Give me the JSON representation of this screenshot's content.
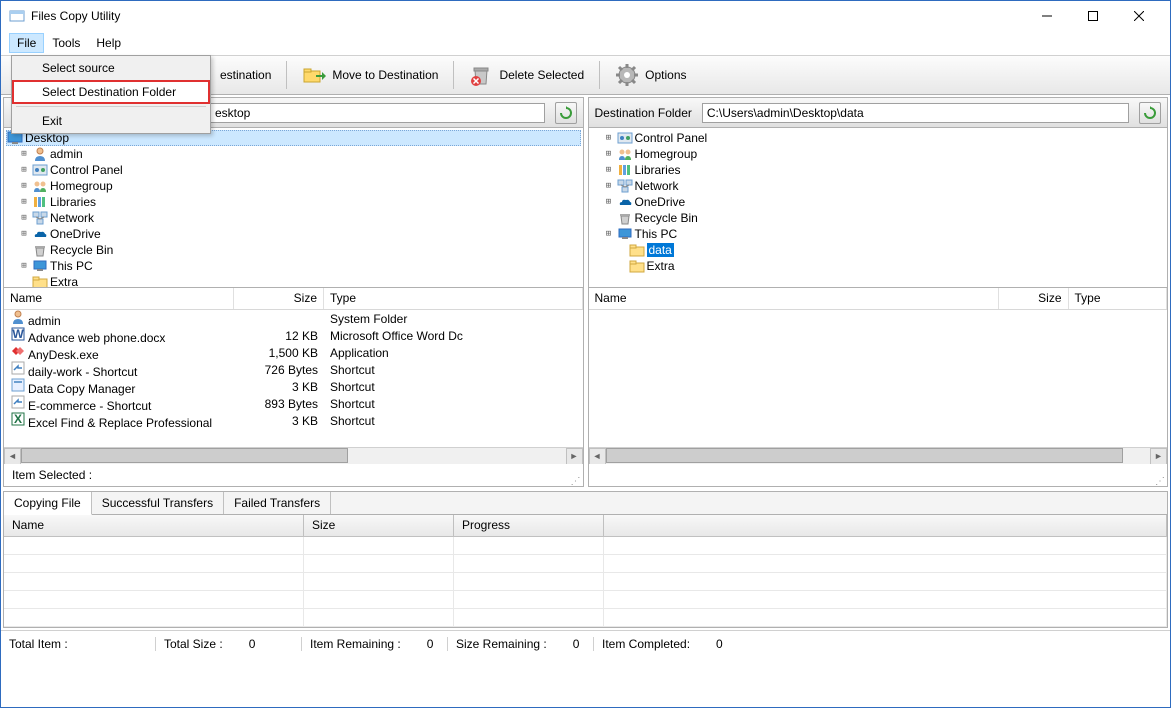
{
  "window": {
    "title": "Files Copy Utility"
  },
  "menubar": {
    "file": "File",
    "tools": "Tools",
    "help": "Help"
  },
  "fileMenu": {
    "select_source": "Select source",
    "select_dest": "Select Destination Folder",
    "exit": "Exit"
  },
  "toolbar": {
    "copy_dest": "estination",
    "move_dest": "Move to Destination",
    "delete_sel": "Delete Selected",
    "options": "Options"
  },
  "leftPane": {
    "header_label": "",
    "path_suffix": "esktop",
    "tree": {
      "root": "Desktop",
      "items": [
        {
          "label": "admin",
          "icon": "user",
          "exp": "+"
        },
        {
          "label": "Control Panel",
          "icon": "cpanel",
          "exp": "+"
        },
        {
          "label": "Homegroup",
          "icon": "homegroup",
          "exp": "+"
        },
        {
          "label": "Libraries",
          "icon": "libraries",
          "exp": "+"
        },
        {
          "label": "Network",
          "icon": "network",
          "exp": "+"
        },
        {
          "label": "OneDrive",
          "icon": "onedrive",
          "exp": "+"
        },
        {
          "label": "Recycle Bin",
          "icon": "recycle",
          "exp": ""
        },
        {
          "label": "This PC",
          "icon": "thispc",
          "exp": "+"
        },
        {
          "label": "Extra",
          "icon": "folder",
          "exp": ""
        }
      ]
    },
    "files": {
      "cols": {
        "name": "Name",
        "size": "Size",
        "type": "Type"
      },
      "rows": [
        {
          "name": "admin",
          "size": "",
          "type": "System Folder",
          "icon": "user"
        },
        {
          "name": "Advance web phone.docx",
          "size": "12 KB",
          "type": "Microsoft Office Word Dc",
          "icon": "word"
        },
        {
          "name": "AnyDesk.exe",
          "size": "1,500 KB",
          "type": "Application",
          "icon": "anydesk"
        },
        {
          "name": "daily-work - Shortcut",
          "size": "726 Bytes",
          "type": "Shortcut",
          "icon": "shortcut"
        },
        {
          "name": "Data Copy Manager",
          "size": "3 KB",
          "type": "Shortcut",
          "icon": "app"
        },
        {
          "name": "E-commerce - Shortcut",
          "size": "893 Bytes",
          "type": "Shortcut",
          "icon": "shortcut"
        },
        {
          "name": "Excel Find & Replace Professional",
          "size": "3 KB",
          "type": "Shortcut",
          "icon": "excel"
        }
      ]
    },
    "status": "Item Selected :"
  },
  "rightPane": {
    "header_label": "Destination Folder",
    "path": "C:\\Users\\admin\\Desktop\\data",
    "tree": {
      "items": [
        {
          "label": "Control Panel",
          "icon": "cpanel",
          "exp": "+",
          "indent": 0
        },
        {
          "label": "Homegroup",
          "icon": "homegroup",
          "exp": "+",
          "indent": 0
        },
        {
          "label": "Libraries",
          "icon": "libraries",
          "exp": "+",
          "indent": 0
        },
        {
          "label": "Network",
          "icon": "network",
          "exp": "+",
          "indent": 0
        },
        {
          "label": "OneDrive",
          "icon": "onedrive",
          "exp": "+",
          "indent": 0
        },
        {
          "label": "Recycle Bin",
          "icon": "recycle",
          "exp": "",
          "indent": 0
        },
        {
          "label": "This PC",
          "icon": "thispc",
          "exp": "+",
          "indent": 0
        },
        {
          "label": "data",
          "icon": "folder",
          "exp": "",
          "indent": 1,
          "selected": true
        },
        {
          "label": "Extra",
          "icon": "folder",
          "exp": "",
          "indent": 1
        }
      ]
    },
    "files": {
      "cols": {
        "name": "Name",
        "size": "Size",
        "type": "Type"
      }
    }
  },
  "tabs": {
    "copying": "Copying File",
    "success": "Successful Transfers",
    "failed": "Failed Transfers",
    "cols": {
      "name": "Name",
      "size": "Size",
      "progress": "Progress"
    }
  },
  "statusbar": {
    "total_item_lbl": "Total Item :",
    "total_item_val": "",
    "total_size_lbl": "Total Size :",
    "total_size_val": "0",
    "remaining_lbl": "Item Remaining :",
    "remaining_val": "0",
    "size_remaining_lbl": "Size Remaining :",
    "size_remaining_val": "0",
    "completed_lbl": "Item Completed:",
    "completed_val": "0"
  }
}
